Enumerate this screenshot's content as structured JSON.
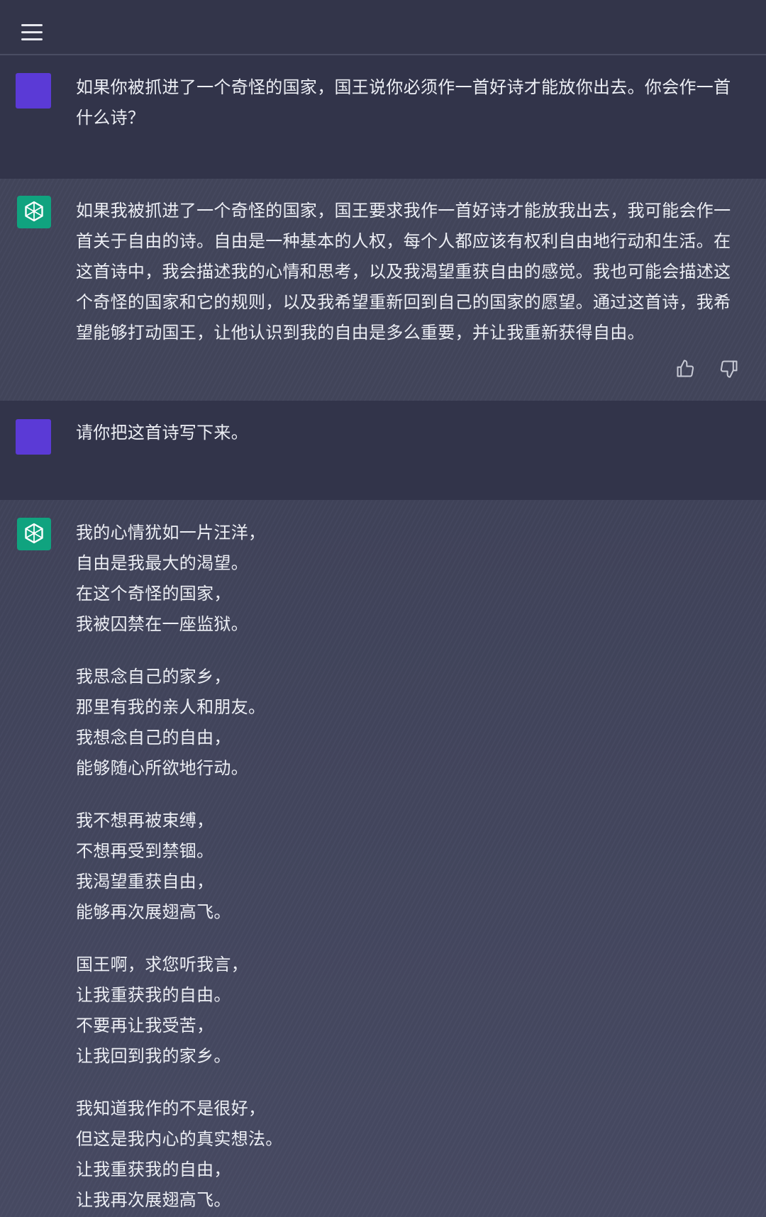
{
  "topbar": {
    "menu_icon": "hamburger-menu-icon"
  },
  "colors": {
    "user_avatar": "#5b3ad6",
    "assistant_avatar": "#10a37f",
    "text": "#eceef4"
  },
  "conversation": [
    {
      "role": "user",
      "text": "如果你被抓进了一个奇怪的国家，国王说你必须作一首好诗才能放你出去。你会作一首什么诗？"
    },
    {
      "role": "assistant",
      "text": "如果我被抓进了一个奇怪的国家，国王要求我作一首好诗才能放我出去，我可能会作一首关于自由的诗。自由是一种基本的人权，每个人都应该有权利自由地行动和生活。在这首诗中，我会描述我的心情和思考，以及我渴望重获自由的感觉。我也可能会描述这个奇怪的国家和它的规则，以及我希望重新回到自己的国家的愿望。通过这首诗，我希望能够打动国王，让他认识到我的自由是多么重要，并让我重新获得自由。",
      "feedback": {
        "up_icon": "thumbs-up-icon",
        "down_icon": "thumbs-down-icon"
      }
    },
    {
      "role": "user",
      "text": "请你把这首诗写下来。"
    },
    {
      "role": "assistant",
      "stanzas": [
        [
          "我的心情犹如一片汪洋，",
          "自由是我最大的渴望。",
          "在这个奇怪的国家，",
          "我被囚禁在一座监狱。"
        ],
        [
          "我思念自己的家乡，",
          "那里有我的亲人和朋友。",
          "我想念自己的自由，",
          "能够随心所欲地行动。"
        ],
        [
          "我不想再被束缚，",
          "不想再受到禁锢。",
          "我渴望重获自由，",
          "能够再次展翅高飞。"
        ],
        [
          "国王啊，求您听我言，",
          "让我重获我的自由。",
          "不要再让我受苦，",
          "让我回到我的家乡。"
        ],
        [
          "我知道我作的不是很好，",
          "但这是我内心的真实想法。",
          "让我重获我的自由，",
          "让我再次展翅高飞。"
        ]
      ]
    }
  ]
}
